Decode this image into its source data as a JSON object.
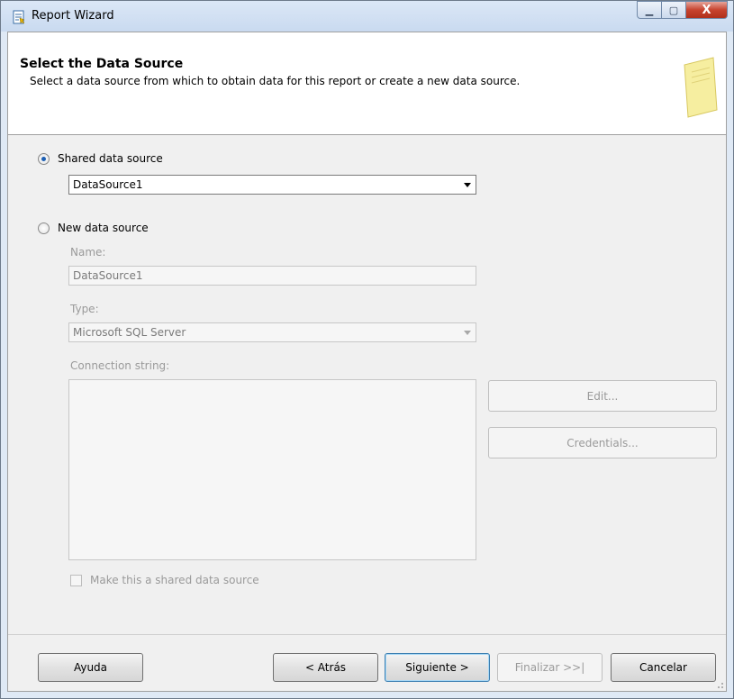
{
  "window": {
    "title": "Report Wizard",
    "min_glyph": "▁",
    "max_glyph": "▢",
    "close_glyph": "X"
  },
  "header": {
    "title": "Select the Data Source",
    "subtitle": "Select a data source from which to obtain data for this report or create a new data source."
  },
  "shared": {
    "label": "Shared data source",
    "selected": true,
    "value": "DataSource1"
  },
  "new_source": {
    "label": "New data source",
    "selected": false,
    "name_label": "Name:",
    "name_value": "DataSource1",
    "type_label": "Type:",
    "type_value": "Microsoft SQL Server",
    "connection_label": "Connection string:",
    "connection_value": "",
    "edit_label": "Edit...",
    "credentials_label": "Credentials...",
    "make_shared_label": "Make this a shared data source",
    "make_shared_checked": false
  },
  "footer": {
    "help_label": "Ayuda",
    "back_label": "< Atrás",
    "next_label": "Siguiente >",
    "finish_label": "Finalizar >>|",
    "cancel_label": "Cancelar"
  },
  "colors": {
    "title_bar": "#c9daf0",
    "close_button": "#c7432e",
    "radio_dot": "#1d5fb3",
    "default_button_border": "#3c7fb1"
  }
}
